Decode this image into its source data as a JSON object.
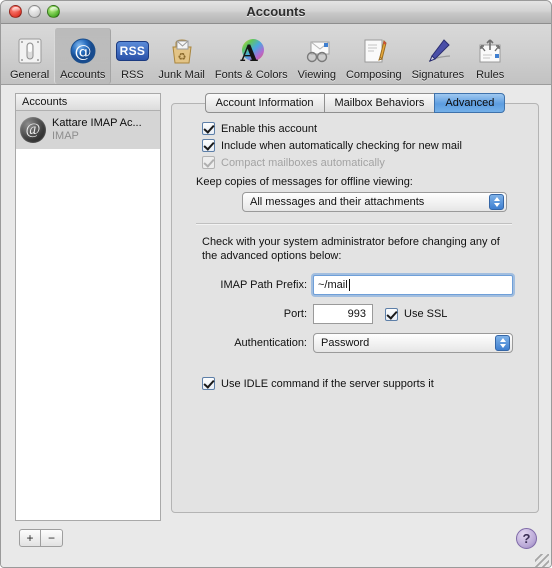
{
  "window": {
    "title": "Accounts",
    "controls": [
      {
        "name": "close",
        "label": "Close"
      },
      {
        "name": "minimize",
        "label": "Minimize"
      },
      {
        "name": "zoom",
        "label": "Zoom"
      }
    ]
  },
  "toolbar": {
    "items": [
      {
        "label": "General",
        "icon": "switch-icon",
        "selected": false
      },
      {
        "label": "Accounts",
        "icon": "at-sign-icon",
        "selected": true
      },
      {
        "label": "RSS",
        "icon": "rss-icon",
        "selected": false
      },
      {
        "label": "Junk Mail",
        "icon": "junk-bag-icon",
        "selected": false
      },
      {
        "label": "Fonts & Colors",
        "icon": "font-color-icon",
        "selected": false
      },
      {
        "label": "Viewing",
        "icon": "glasses-icon",
        "selected": false
      },
      {
        "label": "Composing",
        "icon": "pencil-paper-icon",
        "selected": false
      },
      {
        "label": "Signatures",
        "icon": "fountain-pen-icon",
        "selected": false
      },
      {
        "label": "Rules",
        "icon": "arrows-icon",
        "selected": false
      }
    ]
  },
  "accounts_list": {
    "header": "Accounts",
    "rows": [
      {
        "name": "Kattare IMAP Ac...",
        "kind": "IMAP",
        "icon": "globe-at-icon",
        "selected": true
      }
    ],
    "add_label": "+",
    "remove_label": "−"
  },
  "tabs": [
    {
      "label": "Account Information",
      "active": false
    },
    {
      "label": "Mailbox Behaviors",
      "active": false
    },
    {
      "label": "Advanced",
      "active": true
    }
  ],
  "advanced": {
    "checkboxes": [
      {
        "label": "Enable this account",
        "checked": true,
        "disabled": false
      },
      {
        "label": "Include when automatically checking for new mail",
        "checked": true,
        "disabled": false
      },
      {
        "label": "Compact mailboxes automatically",
        "checked": true,
        "disabled": true
      }
    ],
    "offline_label": "Keep copies of messages for offline viewing:",
    "offline_value": "All messages and their attachments",
    "hint": "Check with your system administrator before changing any of the advanced options below:",
    "path_prefix_label": "IMAP Path Prefix:",
    "path_prefix_value": "~/mail",
    "port_label": "Port:",
    "port_value": "993",
    "use_ssl_label": "Use SSL",
    "use_ssl_checked": true,
    "auth_label": "Authentication:",
    "auth_value": "Password",
    "idle_label": "Use IDLE command if the server supports it",
    "idle_checked": true
  },
  "help": {
    "label": "?"
  },
  "colors": {
    "accent": "#5d9de0",
    "window_bg": "#e8e8e8",
    "panel_bg": "#e3e3e3",
    "help_purple": "#b9a8d6"
  }
}
